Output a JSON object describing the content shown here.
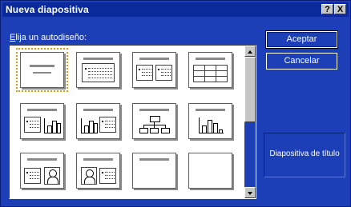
{
  "window": {
    "title": "Nueva diapositiva",
    "help_label": "?",
    "close_label": "X"
  },
  "label": {
    "accel": "E",
    "rest": "lija un autodiseño:"
  },
  "layouts": [
    "Diapositiva de título",
    "Texto",
    "Texto a 2 columnas",
    "Tabla",
    "Texto y gráfico",
    "Gráfico y texto",
    "Organigrama",
    "Gráfico",
    "Texto e imágenes prediseñadas",
    "Imágenes prediseñadas y texto",
    "Sólo el título",
    "En blanco"
  ],
  "selected_layout": "Diapositiva de título",
  "buttons": {
    "ok": "Aceptar",
    "cancel": "Cancelar"
  },
  "preview": {
    "label": "Diapositiva de título"
  },
  "colors": {
    "dialog_bg": "#1c3fb8",
    "titlebar_bg": "#0a2a9c",
    "selection_outline": "#e09a00"
  }
}
